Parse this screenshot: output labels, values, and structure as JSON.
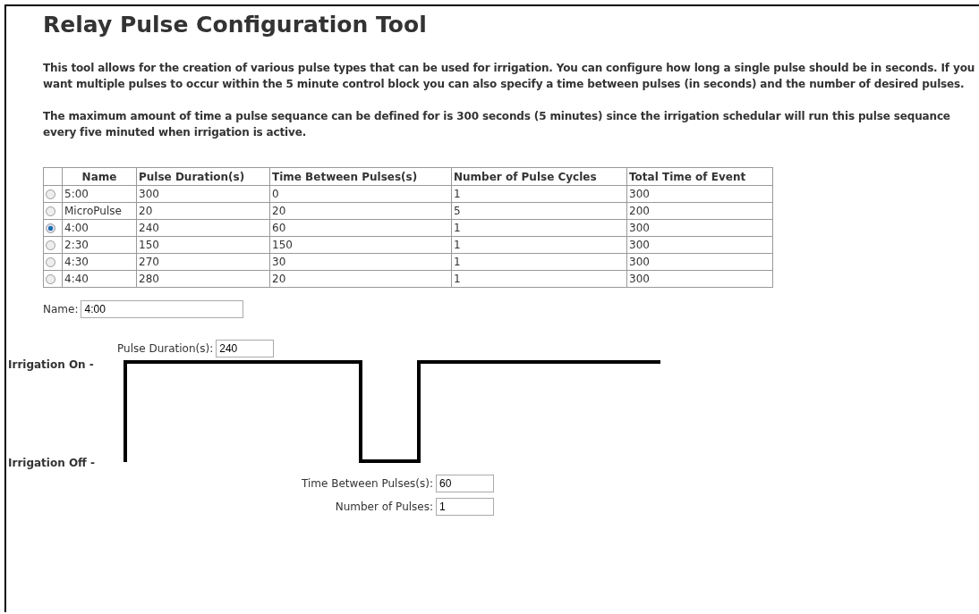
{
  "title": "Relay Pulse Configuration Tool",
  "paragraphs": [
    "This tool allows for the creation of various pulse types that can be used for irrigation. You can configure how long a single pulse should be in seconds. If you want multiple pulses to occur within the 5 minute control block you can also specify a time between pulses (in seconds) and the number of desired pulses.",
    "The maximum amount of time a pulse sequance can be defined for is 300 seconds (5 minutes) since the irrigation schedular will run this pulse sequance every five minuted when irrigation is active."
  ],
  "table": {
    "columns": [
      "Name",
      "Pulse Duration(s)",
      "Time Between Pulses(s)",
      "Number of Pulse Cycles",
      "Total Time of Event"
    ],
    "rows": [
      {
        "selected": false,
        "cells": [
          "5:00",
          "300",
          "0",
          "1",
          "300"
        ]
      },
      {
        "selected": false,
        "cells": [
          "MicroPulse",
          "20",
          "20",
          "5",
          "200"
        ]
      },
      {
        "selected": true,
        "cells": [
          "4:00",
          "240",
          "60",
          "1",
          "300"
        ]
      },
      {
        "selected": false,
        "cells": [
          "2:30",
          "150",
          "150",
          "1",
          "300"
        ]
      },
      {
        "selected": false,
        "cells": [
          "4:30",
          "270",
          "30",
          "1",
          "300"
        ]
      },
      {
        "selected": false,
        "cells": [
          "4:40",
          "280",
          "20",
          "1",
          "300"
        ]
      }
    ]
  },
  "name_field": {
    "label": "Name:",
    "value": "4:00"
  },
  "pulse_duration": {
    "label": "Pulse Duration(s):",
    "value": "240"
  },
  "diagram": {
    "on_label": "Irrigation On -",
    "off_label": "Irrigation Off -"
  },
  "time_between": {
    "label": "Time Between Pulses(s):",
    "value": "60"
  },
  "number_of_pulses": {
    "label": "Number of Pulses:",
    "value": "1"
  }
}
